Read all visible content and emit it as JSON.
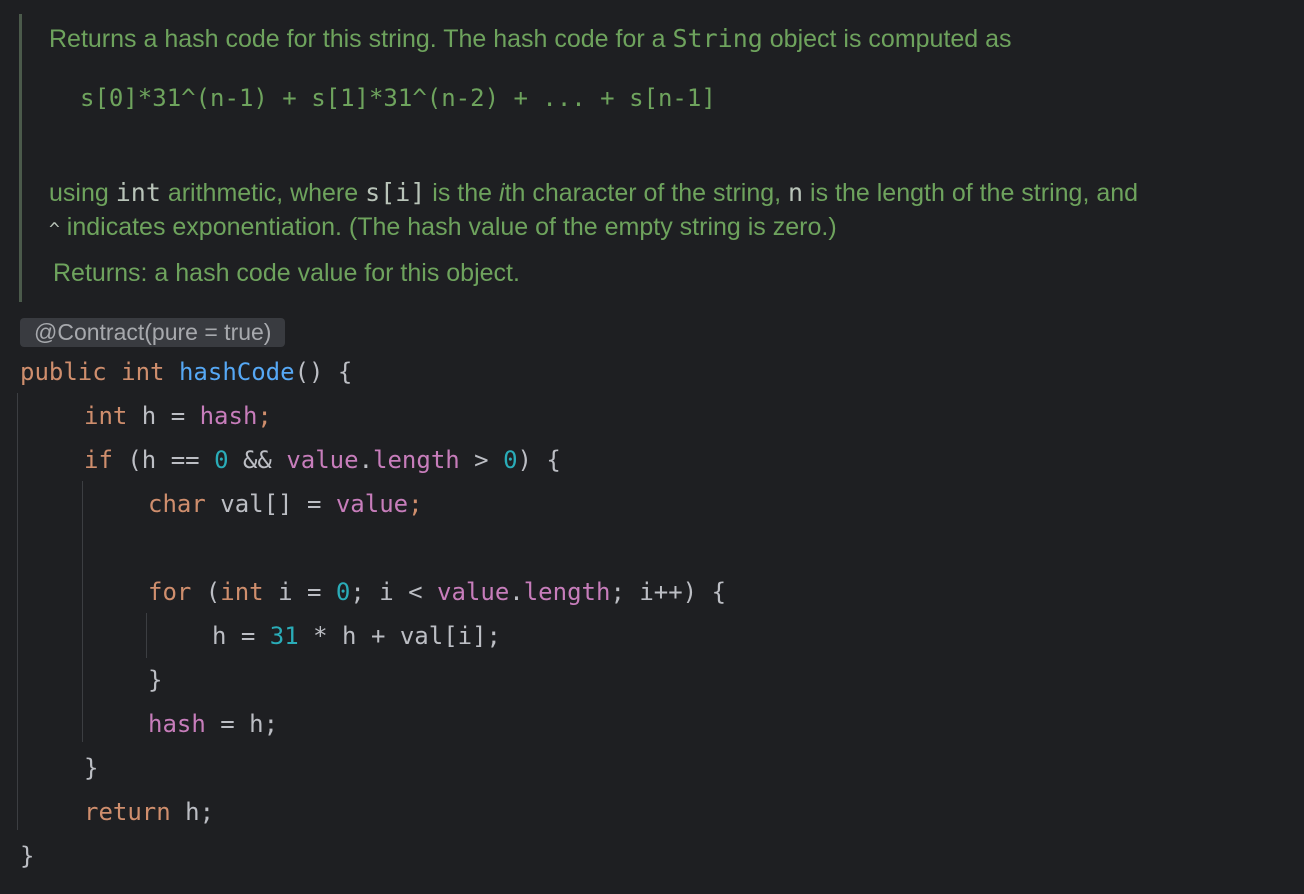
{
  "doc": {
    "line1_prefix": "Returns a hash code for this string. The hash code for a ",
    "line1_code": "String",
    "line1_suffix": " object is computed as",
    "formula": "s[0]*31^(n-1) + s[1]*31^(n-2) + ... + s[n-1]",
    "line3_a": "using ",
    "line3_code1": "int",
    "line3_b": " arithmetic, where ",
    "line3_code2": "s[i]",
    "line3_c": " is the ",
    "line3_italic": "i",
    "line3_d": "th character of the string, ",
    "line3_code3": "n",
    "line3_e": " is the length of the string, and",
    "line4_code": "^",
    "line4_text": " indicates exponentiation. (The hash value of the empty string is zero.)",
    "returns_label": "Returns:",
    "returns_text": " a hash code value for this object."
  },
  "annotation": "@Contract(pure = true)",
  "code": {
    "l1": {
      "kw1": "public",
      "kw2": "int",
      "name": "hashCode",
      "rest": "() {"
    },
    "l2": {
      "kw": "int",
      "mid": " h = ",
      "field": "hash",
      "end": ";"
    },
    "l3": {
      "kw": "if",
      "a": " (h == ",
      "n0": "0",
      "b": " && ",
      "field1": "value",
      "dot": ".",
      "field2": "length",
      "c": " > ",
      "n1": "0",
      "d": ") {"
    },
    "l4": {
      "kw": "char",
      "mid": " val[] = ",
      "field": "value",
      "end": ";"
    },
    "l6": {
      "kw1": "for",
      "a": " (",
      "kw2": "int",
      "b": " i = ",
      "n0": "0",
      "c": "; i < ",
      "field1": "value",
      "dot": ".",
      "field2": "length",
      "d": "; i++) {"
    },
    "l7": {
      "a": "h = ",
      "num": "31",
      "b": " * h + val[i];"
    },
    "l8": "}",
    "l9": {
      "field": "hash",
      "rest": " = h;"
    },
    "l10": "}",
    "l11": {
      "kw": "return",
      "rest": " h;"
    },
    "l12": "}"
  }
}
